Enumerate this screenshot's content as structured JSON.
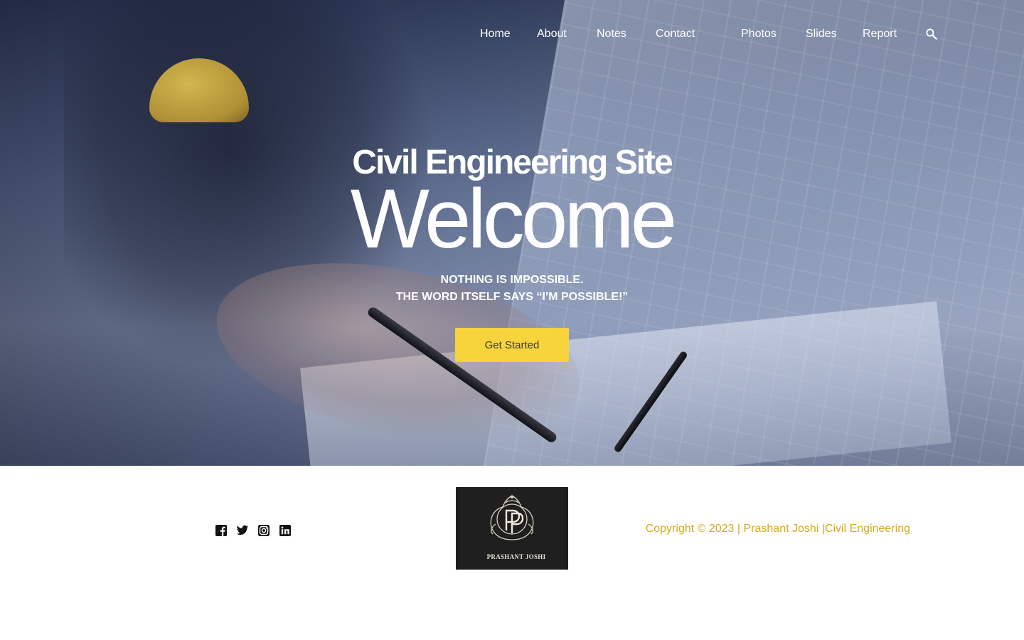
{
  "nav": {
    "items": [
      {
        "label": "Home"
      },
      {
        "label": "About"
      },
      {
        "label": "Notes"
      },
      {
        "label": "Contact"
      },
      {
        "label": "Photos"
      },
      {
        "label": "Slides"
      },
      {
        "label": "Report"
      }
    ],
    "search_icon": "search-icon"
  },
  "hero": {
    "title": "Civil Engineering Site",
    "welcome": "Welcome",
    "tagline_line1": "NOTHING IS IMPOSSIBLE.",
    "tagline_line2": "THE WORD ITSELF SAYS “I’M POSSIBLE!”",
    "cta_label": "Get Started",
    "cta_color": "#f7d33c"
  },
  "footer": {
    "social_icons": [
      "facebook-icon",
      "twitter-icon",
      "instagram-icon",
      "linkedin-icon"
    ],
    "logo_text": "PRASHANT JOSHI",
    "copyright": "Copyright © 2023 | Prashant Joshi |Civil Engineering",
    "copyright_color": "#d5a81a"
  }
}
